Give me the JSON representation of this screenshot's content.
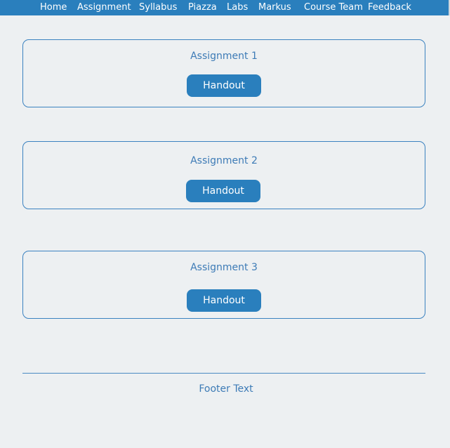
{
  "nav": {
    "items": [
      {
        "label": "Home"
      },
      {
        "label": "Assignment"
      },
      {
        "label": "Syllabus"
      },
      {
        "label": "Piazza"
      },
      {
        "label": "Labs"
      },
      {
        "label": "Markus"
      },
      {
        "label": "Course Team"
      },
      {
        "label": "Feedback"
      }
    ]
  },
  "assignments": [
    {
      "title": "Assignment 1",
      "button_label": "Handout"
    },
    {
      "title": "Assignment 2",
      "button_label": "Handout"
    },
    {
      "title": "Assignment 3",
      "button_label": "Handout"
    }
  ],
  "footer": {
    "text": "Footer Text"
  },
  "colors": {
    "nav_background": "#2a7fbd",
    "page_background": "#edf0f2",
    "accent_text": "#3d7bb6",
    "card_border": "#3b82c0",
    "button_background": "#2a7fbd"
  }
}
